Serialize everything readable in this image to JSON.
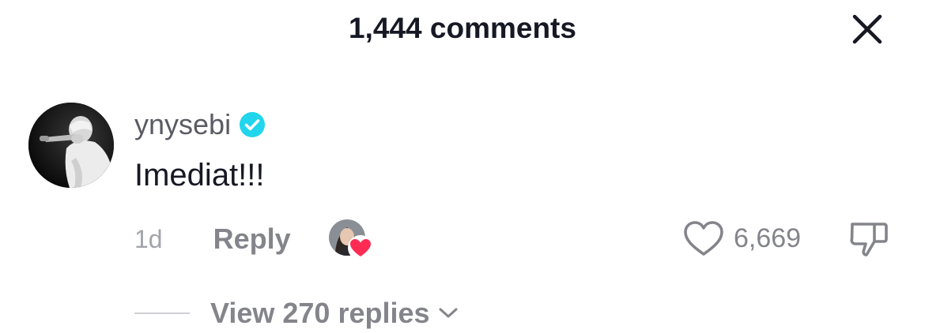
{
  "header": {
    "title": "1,444 comments",
    "close_icon": "close-icon"
  },
  "comment": {
    "username": "ynysebi",
    "verified_icon": "verified-badge-icon",
    "text": "Imediat!!!",
    "timestamp": "1d",
    "reply_label": "Reply",
    "creator_liked_icon": "heart-icon",
    "like_icon": "heart-outline-icon",
    "like_count": "6,669",
    "dislike_icon": "thumbs-down-icon",
    "view_replies_label": "View 270 replies",
    "expand_icon": "chevron-down-icon"
  },
  "colors": {
    "verified": "#20D5EC",
    "creator_heart": "#FE2C55",
    "text_primary": "#161823",
    "text_secondary": "#84858B"
  }
}
